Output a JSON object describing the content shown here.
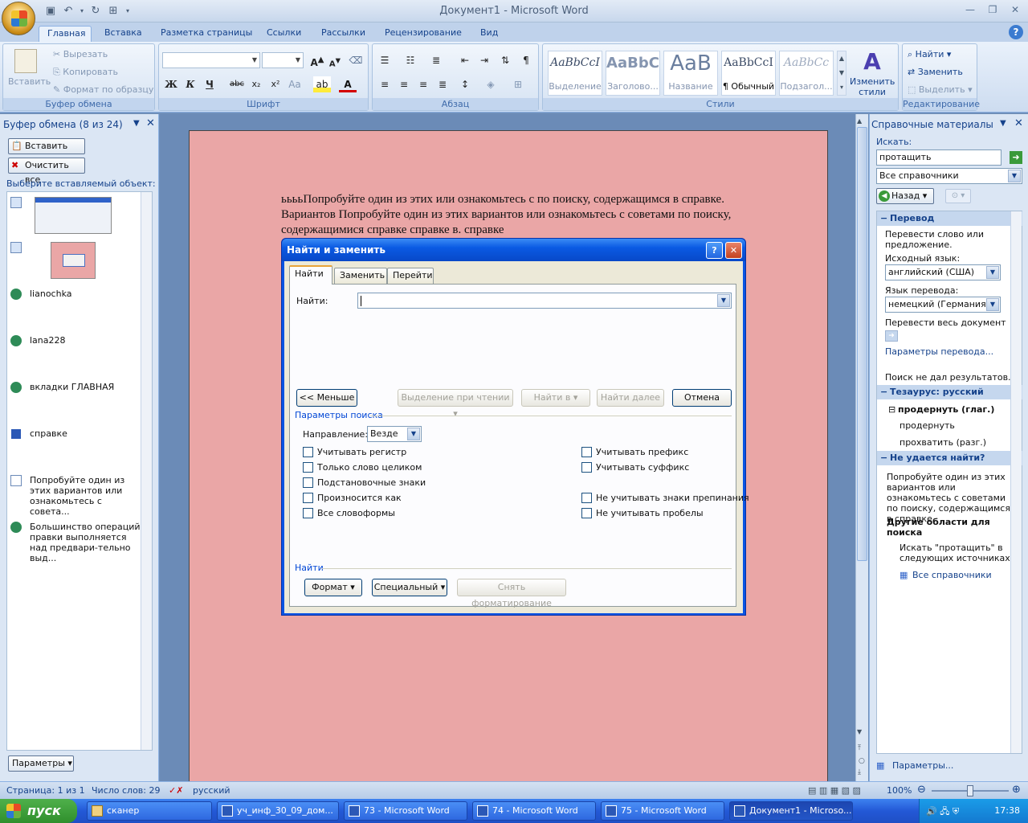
{
  "window": {
    "title": "Документ1 - Microsoft Word"
  },
  "ribbon": {
    "tabs": [
      "Главная",
      "Вставка",
      "Разметка страницы",
      "Ссылки",
      "Рассылки",
      "Рецензирование",
      "Вид"
    ],
    "clipboard": {
      "paste": "Вставить",
      "cut": "Вырезать",
      "copy": "Копировать",
      "format_painter": "Формат по образцу",
      "label": "Буфер обмена"
    },
    "font": {
      "label": "Шрифт"
    },
    "paragraph": {
      "label": "Абзац"
    },
    "styles": {
      "label": "Стили",
      "items": [
        {
          "sample": "AaBbCcI",
          "name": "Выделение"
        },
        {
          "sample": "AaBbC",
          "name": "Заголово..."
        },
        {
          "sample": "AaB",
          "name": "Название"
        },
        {
          "sample": "AaBbCcI",
          "name": "¶ Обычный"
        },
        {
          "sample": "AaBbCc",
          "name": "Подзагол..."
        }
      ],
      "change_styles": "Изменить стили"
    },
    "editing": {
      "find": "Найти",
      "replace": "Заменить",
      "select": "Выделить",
      "label": "Редактирование"
    }
  },
  "clipboard_pane": {
    "title": "Буфер обмена (8 из 24)",
    "paste_all": "Вставить все",
    "clear_all": "Очистить все",
    "prompt": "Выберите вставляемый объект:",
    "items": [
      "lianochka",
      "lana228",
      "вкладки ГЛАВНАЯ",
      "справке",
      "Попробуйте один из этих вариантов или ознакомьтесь с совета...",
      "Большинство операций правки выполняется над предвари-тельно выд..."
    ],
    "options": "Параметры"
  },
  "document": {
    "lines": [
      "ььььПопробуйте один из этих или ознакомьтесь с по поиску, содержащимся в справке.",
      "Вариантов Попробуйте один из этих вариантов или ознакомьтесь с советами по поиску,",
      "содержащимися справке справке в.     справке"
    ]
  },
  "dialog": {
    "title": "Найти и заменить",
    "tabs": [
      "Найти",
      "Заменить",
      "Перейти"
    ],
    "find_label": "Найти:",
    "find_value": "",
    "less_btn": "<< Меньше",
    "reading_highlight": "Выделение при чтении",
    "find_in": "Найти в",
    "find_next": "Найти далее",
    "cancel": "Отмена",
    "search_options": "Параметры поиска",
    "direction_label": "Направление:",
    "direction_value": "Везде",
    "left_checks": [
      "Учитывать регистр",
      "Только слово целиком",
      "Подстановочные знаки",
      "Произносится как",
      "Все словоформы"
    ],
    "right_checks": [
      "Учитывать префикс",
      "Учитывать суффикс",
      "Не учитывать знаки препинания",
      "Не учитывать пробелы"
    ],
    "find_section": "Найти",
    "format_btn": "Формат",
    "special_btn": "Специальный",
    "clear_format": "Снять форматирование"
  },
  "research_pane": {
    "title": "Справочные материалы",
    "search_label": "Искать:",
    "search_value": "протащить",
    "source": "Все справочники",
    "back": "Назад",
    "translate_head": "Перевод",
    "translate_desc": "Перевести слово или предложение.",
    "src_lang_label": "Исходный язык:",
    "src_lang": "английский (США)",
    "dst_lang_label": "Язык перевода:",
    "dst_lang": "немецкий (Германия)",
    "translate_doc": "Перевести весь документ",
    "translate_params": "Параметры перевода...",
    "no_results": "Поиск не дал результатов.",
    "thesaurus_head": "Тезаурус: русский",
    "thes_entry": "продернуть (глаг.)",
    "thes_1": "продернуть",
    "thes_2": "прохватить (разг.)",
    "not_found_head": "Не удается найти?",
    "not_found_desc": "Попробуйте один из этих вариантов или ознакомьтесь с советами по поиску, содержащимся в справке.",
    "other_areas": "Другие области для поиска",
    "search_in": "Искать \"протащить\" в следующих источниках:",
    "all_refs": "Все справочники",
    "params": "Параметры..."
  },
  "statusbar": {
    "page": "Страница: 1 из 1",
    "words": "Число слов: 29",
    "lang": "русский",
    "zoom": "100%"
  },
  "taskbar": {
    "start": "пуск",
    "tasks": [
      "сканер",
      "уч_инф_30_09_дом...",
      "73 - Microsoft Word",
      "74 - Microsoft Word",
      "75 - Microsoft Word",
      "Документ1 - Microso..."
    ],
    "lang": "RU",
    "time": "17:38"
  }
}
